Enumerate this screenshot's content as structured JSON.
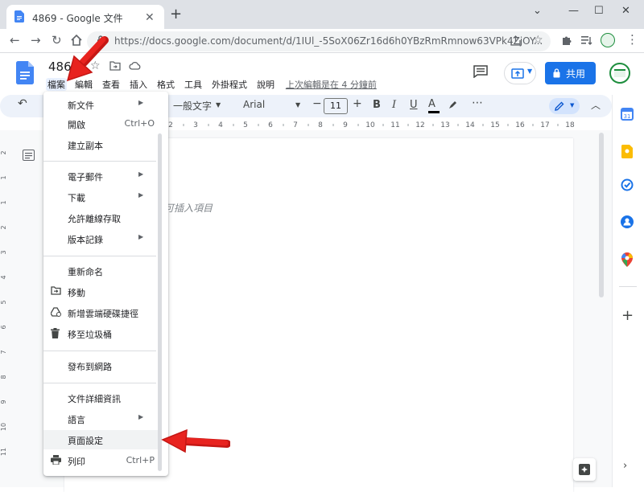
{
  "browser": {
    "tab_title": "4869 - Google 文件",
    "url": "https://docs.google.com/document/d/1IUl_-5SoX06Zr16d6h0YBzRmRmnow63VPk4ZjOY...",
    "new_tab": "+",
    "close_tab": "✕"
  },
  "docs": {
    "doc_title": "486",
    "menus": [
      "檔案",
      "編輯",
      "查看",
      "插入",
      "格式",
      "工具",
      "外掛程式",
      "說明"
    ],
    "last_edit": "上次編輯是在 4 分鐘前",
    "share_label": "共用"
  },
  "toolbar": {
    "style": "一般文字",
    "font": "Arial",
    "font_size": "11"
  },
  "ruler": {
    "ticks": [
      "2",
      "3",
      "4",
      "5",
      "6",
      "7",
      "8",
      "9",
      "10",
      "11",
      "12",
      "13",
      "14",
      "15",
      "16",
      "17",
      "18"
    ]
  },
  "vruler": {
    "ticks": [
      "2",
      "1",
      "1",
      "2",
      "3",
      "4",
      "5",
      "6",
      "7",
      "8",
      "9",
      "10",
      "11"
    ]
  },
  "document": {
    "placeholder": "可插入項目"
  },
  "file_menu": {
    "items": [
      {
        "label": "新文件",
        "shortcut": "",
        "submenu": true,
        "icon": ""
      },
      {
        "label": "開啟",
        "shortcut": "Ctrl+O",
        "submenu": false,
        "icon": ""
      },
      {
        "label": "建立副本",
        "shortcut": "",
        "submenu": false,
        "icon": ""
      },
      {
        "label": "電子郵件",
        "shortcut": "",
        "submenu": true,
        "icon": ""
      },
      {
        "label": "下載",
        "shortcut": "",
        "submenu": true,
        "icon": ""
      },
      {
        "label": "允許離線存取",
        "shortcut": "",
        "submenu": false,
        "icon": ""
      },
      {
        "label": "版本記錄",
        "shortcut": "",
        "submenu": true,
        "icon": ""
      },
      {
        "label": "重新命名",
        "shortcut": "",
        "submenu": false,
        "icon": ""
      },
      {
        "label": "移動",
        "shortcut": "",
        "submenu": false,
        "icon": "move-folder-icon"
      },
      {
        "label": "新增雲端硬碟捷徑",
        "shortcut": "",
        "submenu": false,
        "icon": "drive-shortcut-icon"
      },
      {
        "label": "移至垃圾桶",
        "shortcut": "",
        "submenu": false,
        "icon": "trash-icon"
      },
      {
        "label": "發布到網路",
        "shortcut": "",
        "submenu": false,
        "icon": ""
      },
      {
        "label": "文件詳細資訊",
        "shortcut": "",
        "submenu": false,
        "icon": ""
      },
      {
        "label": "語言",
        "shortcut": "",
        "submenu": true,
        "icon": ""
      },
      {
        "label": "頁面設定",
        "shortcut": "",
        "submenu": false,
        "icon": ""
      },
      {
        "label": "列印",
        "shortcut": "Ctrl+P",
        "submenu": false,
        "icon": "print-icon"
      }
    ]
  },
  "colors": {
    "accent": "#1a73e8",
    "annotation_arrow": "#e8231f",
    "menu_highlight": "#f1f3f4"
  }
}
